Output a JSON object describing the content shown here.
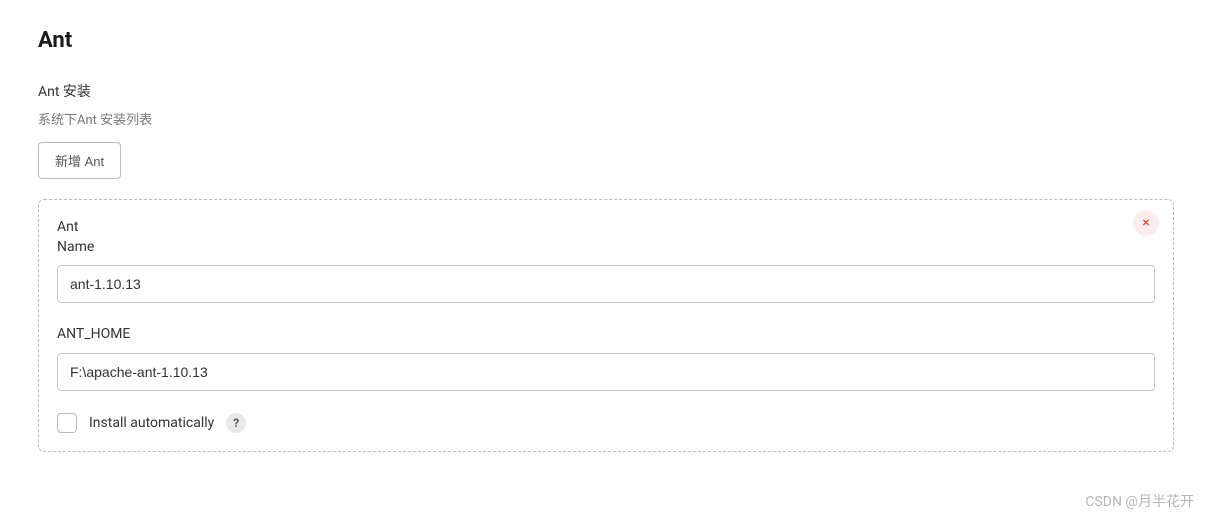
{
  "page": {
    "title": "Ant"
  },
  "section": {
    "heading": "Ant 安装",
    "subheading": "系统下Ant 安装列表",
    "addButtonLabel": "新增 Ant"
  },
  "installation": {
    "typeLabel": "Ant",
    "nameLabel": "Name",
    "nameValue": "ant-1.10.13",
    "homeLabel": "ANT_HOME",
    "homeValue": "F:\\apache-ant-1.10.13",
    "autoInstallLabel": "Install automatically",
    "helpIconText": "?",
    "deleteIconText": "×"
  },
  "watermark": "CSDN @月半花开"
}
